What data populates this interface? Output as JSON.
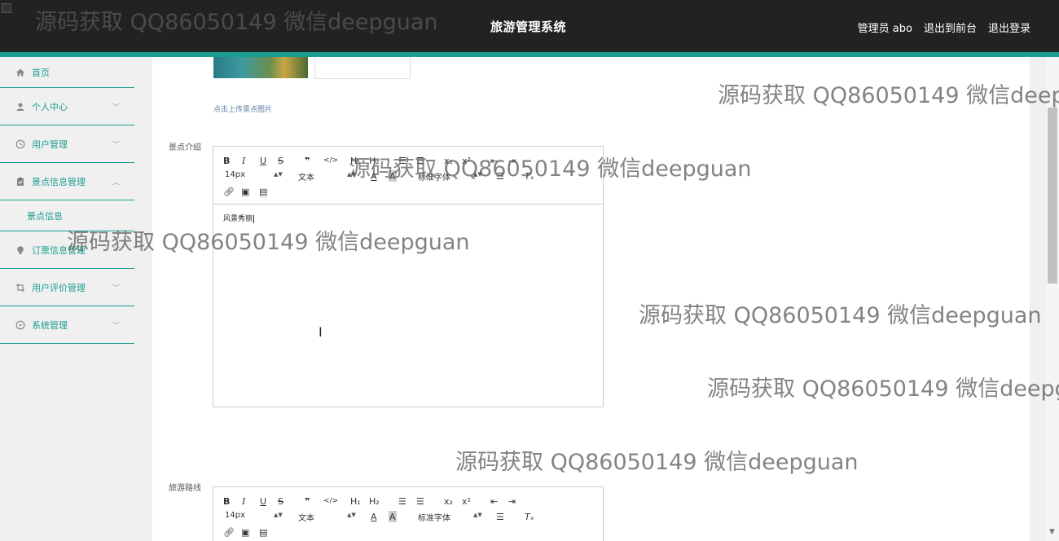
{
  "header": {
    "title": "旅游管理系统",
    "admin_label": "管理员 abo",
    "exit_front": "退出到前台",
    "logout": "退出登录"
  },
  "sidebar": {
    "items": [
      {
        "label": "首页",
        "icon": "home-icon"
      },
      {
        "label": "个人中心",
        "icon": "user-icon"
      },
      {
        "label": "用户管理",
        "icon": "clock-icon"
      },
      {
        "label": "景点信息管理",
        "icon": "clipboard-icon",
        "expanded": true
      },
      {
        "label": "景点信息",
        "icon": ""
      },
      {
        "label": "订票信息管理",
        "icon": "bulb-icon"
      },
      {
        "label": "用户评价管理",
        "icon": "crop-icon"
      },
      {
        "label": "系统管理",
        "icon": "compass-icon"
      }
    ]
  },
  "form": {
    "upload_hint": "点击上传景点图片",
    "intro_label": "景点介绍",
    "route_label": "旅游路线",
    "intro_content": "风景秀丽"
  },
  "editor_toolbar": {
    "font_size": "14px",
    "paragraph": "文本",
    "font_family": "标准字体",
    "h1": "H₁",
    "h2": "H₂",
    "sub": "x₂",
    "sup": "x²",
    "clear": "Tₓ"
  },
  "watermark": "源码获取 QQ86050149 微信deepguan",
  "colors": {
    "accent": "#1a9e8f",
    "topbar": "#222222"
  }
}
